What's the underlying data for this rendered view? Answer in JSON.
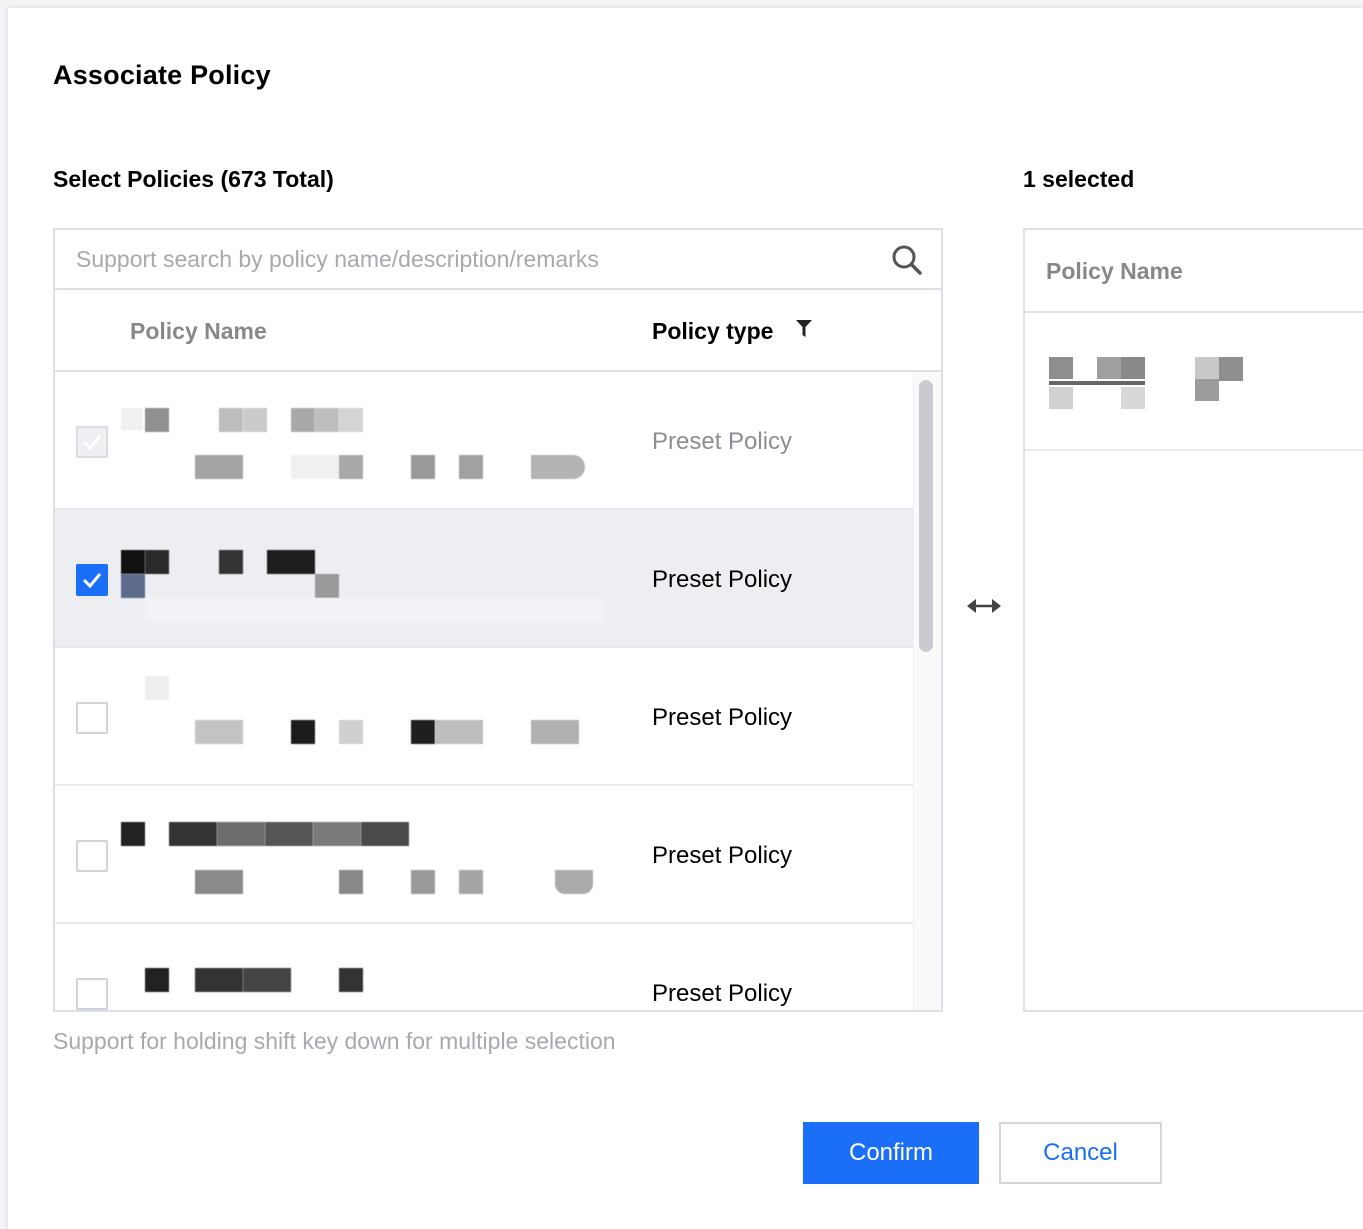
{
  "dialog": {
    "title": "Associate Policy"
  },
  "left": {
    "heading": "Select Policies (673 Total)",
    "search_placeholder": "Support search by policy name/description/remarks",
    "columns": {
      "name": "Policy Name",
      "type": "Policy type"
    },
    "rows": [
      {
        "type": "Preset Policy",
        "state": "disabled-checked"
      },
      {
        "type": "Preset Policy",
        "state": "checked"
      },
      {
        "type": "Preset Policy",
        "state": "unchecked"
      },
      {
        "type": "Preset Policy",
        "state": "unchecked"
      },
      {
        "type": "Preset Policy",
        "state": "unchecked"
      }
    ],
    "hint": "Support for holding shift key down for multiple selection"
  },
  "right": {
    "heading": "1 selected",
    "column": "Policy Name"
  },
  "buttons": {
    "confirm": "Confirm",
    "cancel": "Cancel"
  },
  "colors": {
    "accent": "#1a6ef7",
    "border": "#dcdfe6",
    "muted_text": "#a6a9ae"
  },
  "icons": [
    "search-icon",
    "filter-icon",
    "check-icon",
    "swap-arrows-icon"
  ]
}
